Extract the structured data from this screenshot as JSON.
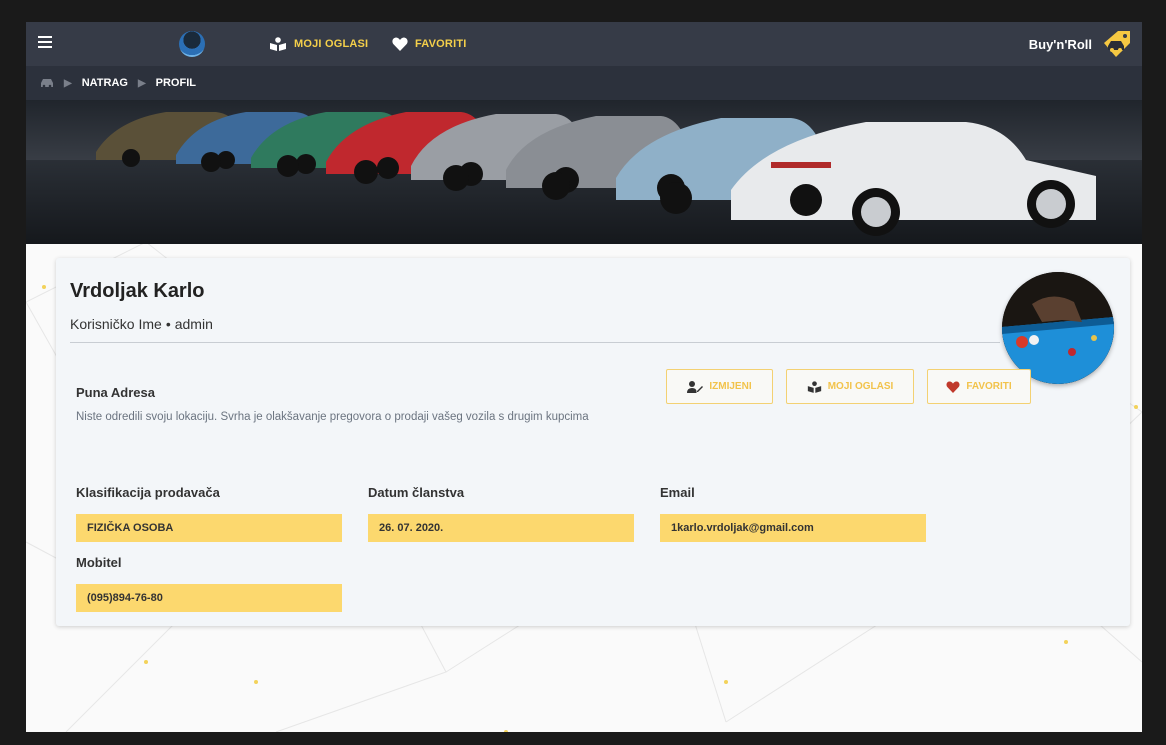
{
  "nav": {
    "moji_oglasi": "MOJI OGLASI",
    "favoriti": "FAVORITI",
    "brand": "Buy'n'Roll"
  },
  "breadcrumb": {
    "items": [
      "NATRAG",
      "PROFIL"
    ]
  },
  "profile": {
    "name": "Vrdoljak Karlo",
    "username_label": "Korisničko Ime",
    "username_sep": "•",
    "username": "admin"
  },
  "address": {
    "title": "Puna Adresa",
    "text": "Niste odredili svoju lokaciju. Svrha je olakšavanje pregovora o prodaji vašeg vozila s drugim kupcima"
  },
  "actions": {
    "edit": "IZMIJENI",
    "my_ads": "MOJI OGLASI",
    "favorites": "FAVORITI"
  },
  "fields": {
    "classification": {
      "label": "Klasifikacija prodavača",
      "value": "FIZIČKA OSOBA"
    },
    "member_since": {
      "label": "Datum članstva",
      "value": "26. 07. 2020."
    },
    "email": {
      "label": "Email",
      "value": "1karlo.vrdoljak@gmail.com"
    },
    "mobile": {
      "label": "Mobitel",
      "value": "(095)894-76-80"
    }
  },
  "colors": {
    "accent": "#f5d04a",
    "nav_bg": "#363b47",
    "field_bg": "#fcd86e",
    "heart": "#c0392b"
  }
}
